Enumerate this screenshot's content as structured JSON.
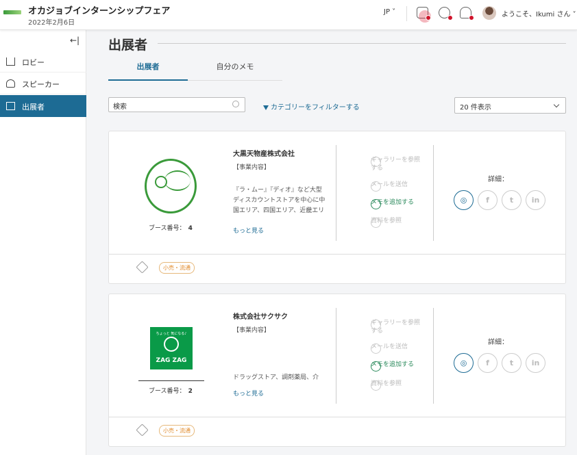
{
  "header": {
    "app_title": "オカジョブインターンシップフェア",
    "date": "2022年2月6日",
    "language": "JP ˅",
    "welcome": "ようこそ、Ikumi さん ˅"
  },
  "sidebar": {
    "collapse_symbol": "←|",
    "items": [
      {
        "label": "ロビー",
        "icon": "home-icon"
      },
      {
        "label": "スピーカー",
        "icon": "speaker-icon"
      },
      {
        "label": "出展者",
        "icon": "exhibitor-icon",
        "active": true
      }
    ]
  },
  "main": {
    "title": "出展者",
    "tabs": [
      {
        "label": "出展者",
        "active": true
      },
      {
        "label": "自分のメモ",
        "active": false
      }
    ],
    "search": {
      "value": "検索"
    },
    "filter_label": "カテゴリーをフィルターする",
    "per_page": "20 件表示",
    "details_label": "詳細：",
    "actions": {
      "gallery": "ギャラリーを参照する",
      "send_mail": "メールを送信",
      "add_memo": "メモを追加する",
      "view_docs": "資料を参照"
    },
    "exhibitors": [
      {
        "company": "大黒天物産株式会社",
        "biz_label": "【事業内容】",
        "description": "『ラ・ムー』『ディオ』など大型ディスカウントストアを中心に中国エリア、四国エリア、近畿エリア、九州エリア、中部エリア",
        "more": "もっと見る",
        "booth_label": "ブース番号：",
        "booth_no": "4",
        "tag": "小売・流通"
      },
      {
        "company": "株式会社サクサク",
        "biz_label": "【事業内容】",
        "description": "ドラッグストア、調剤薬局、介",
        "more": "もっと見る",
        "booth_label": "ブース番号：",
        "booth_no": "2",
        "tag": "小売・流通",
        "logo_small_text": "ちょっと 気になる♪",
        "logo_text": "ZAG ZAG"
      }
    ]
  },
  "colors": {
    "accent": "#1d6b94",
    "green": "#2b8a5c",
    "notification": "#d0142b"
  }
}
